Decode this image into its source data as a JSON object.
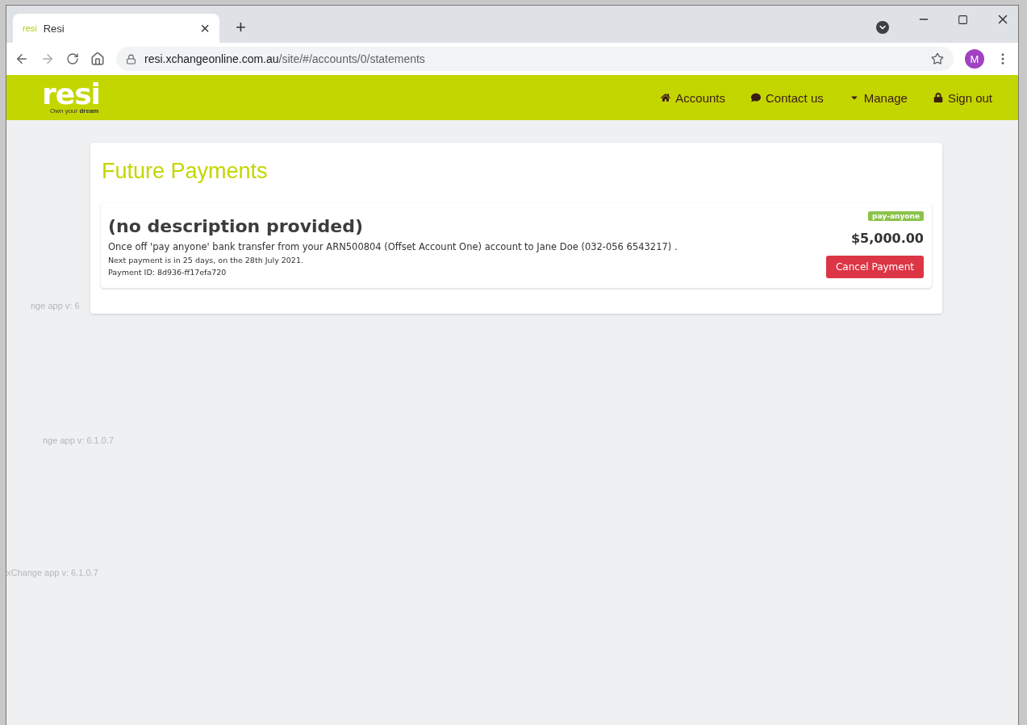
{
  "browser": {
    "tab": {
      "favicon_text": "resi",
      "title": "Resi",
      "close": "×"
    },
    "new_tab": "+",
    "url": {
      "host": "resi.xchangeonline.com.au",
      "path": "/site/#/accounts/0/statements"
    },
    "profile": "M"
  },
  "navbar": {
    "logo": {
      "wordmark": "resi",
      "tagline_plain": "Own your ",
      "tagline_bold": "dream"
    },
    "items": [
      {
        "label": "Accounts",
        "kind": "home"
      },
      {
        "label": "Contact us",
        "kind": "comment"
      },
      {
        "label": "Manage",
        "kind": "caret"
      },
      {
        "label": "Sign out",
        "kind": "lock"
      }
    ]
  },
  "page": {
    "title": "Future Payments",
    "payments": [
      {
        "description": "(no description provided)",
        "detail": "Once off 'pay anyone' bank transfer from your ARN500804 (Offset Account One) account to Jane Doe (032-056 6543217) .",
        "next": "Next payment is in 25 days, on the 28th July 2021.",
        "payment_id": "Payment ID: 8d936-ff17efa720",
        "tag": "pay-anyone",
        "amount": "$5,000.00",
        "action": "Cancel Payment"
      }
    ]
  },
  "version_labels": [
    "nge app v: 6",
    "nge app v: 6.1.0.7",
    "xChange app v: 6.1.0.7"
  ]
}
